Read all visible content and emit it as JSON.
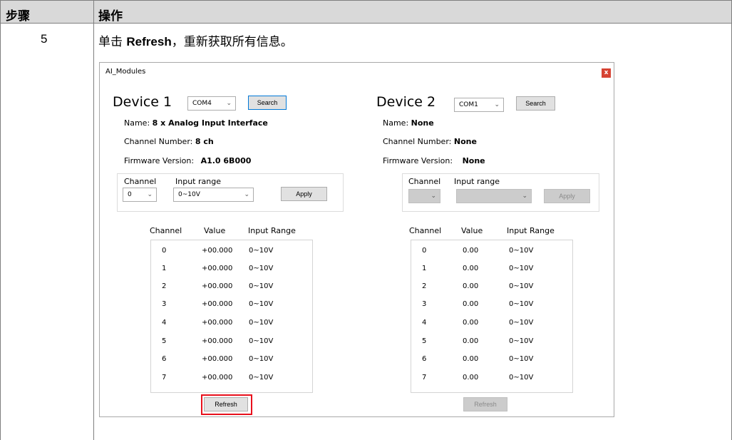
{
  "doc": {
    "header_step": "步骤",
    "header_operation": "操作",
    "step_number": "5",
    "instruction_before": "单击",
    "instruction_bold": "Refresh",
    "instruction_after": "，重新获取所有信息。"
  },
  "window": {
    "title": "AI_Modules",
    "close_glyph": "x"
  },
  "device1": {
    "title": "Device 1",
    "port": "COM4",
    "search_label": "Search",
    "name_label": "Name:",
    "name_value": "8 x Analog Input Interface",
    "channel_number_label": "Channel Number:",
    "channel_number_value": "8 ch",
    "firmware_label": "Firmware Version:",
    "firmware_value": "A1.0 6B000",
    "channel_label": "Channel",
    "input_range_label": "Input range",
    "channel_select": "0",
    "range_select": "0~10V",
    "apply_label": "Apply",
    "table_headers": [
      "Channel",
      "Value",
      "Input Range"
    ],
    "rows": [
      {
        "ch": "0",
        "value": "+00.000",
        "range": "0~10V"
      },
      {
        "ch": "1",
        "value": "+00.000",
        "range": "0~10V"
      },
      {
        "ch": "2",
        "value": "+00.000",
        "range": "0~10V"
      },
      {
        "ch": "3",
        "value": "+00.000",
        "range": "0~10V"
      },
      {
        "ch": "4",
        "value": "+00.000",
        "range": "0~10V"
      },
      {
        "ch": "5",
        "value": "+00.000",
        "range": "0~10V"
      },
      {
        "ch": "6",
        "value": "+00.000",
        "range": "0~10V"
      },
      {
        "ch": "7",
        "value": "+00.000",
        "range": "0~10V"
      }
    ],
    "refresh_label": "Refresh"
  },
  "device2": {
    "title": "Device 2",
    "port": "COM1",
    "search_label": "Search",
    "name_label": "Name:",
    "name_value": "None",
    "channel_number_label": "Channel Number:",
    "channel_number_value": "None",
    "firmware_label": "Firmware Version:",
    "firmware_value": "None",
    "channel_label": "Channel",
    "input_range_label": "Input range",
    "apply_label": "Apply",
    "table_headers": [
      "Channel",
      "Value",
      "Input Range"
    ],
    "rows": [
      {
        "ch": "0",
        "value": "0.00",
        "range": "0~10V"
      },
      {
        "ch": "1",
        "value": "0.00",
        "range": "0~10V"
      },
      {
        "ch": "2",
        "value": "0.00",
        "range": "0~10V"
      },
      {
        "ch": "3",
        "value": "0.00",
        "range": "0~10V"
      },
      {
        "ch": "4",
        "value": "0.00",
        "range": "0~10V"
      },
      {
        "ch": "5",
        "value": "0.00",
        "range": "0~10V"
      },
      {
        "ch": "6",
        "value": "0.00",
        "range": "0~10V"
      },
      {
        "ch": "7",
        "value": "0.00",
        "range": "0~10V"
      }
    ],
    "refresh_label": "Refresh"
  },
  "colors": {
    "highlight": "#e8101c",
    "header_bg": "#d9d9d9",
    "close_button": "#d64333",
    "focus_border": "#0078d7"
  }
}
